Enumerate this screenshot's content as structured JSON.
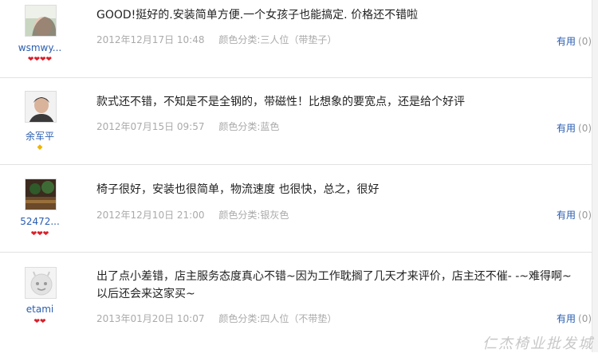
{
  "reviews": [
    {
      "username": "wsmwy...",
      "badge": "❤❤❤❤",
      "content": "GOOD!挺好的.安装简单方便.一个女孩子也能搞定. 价格还不错啦",
      "date": "2012年12月17日 10:48",
      "variant": "颜色分类:三人位（带垫子）",
      "useful_label": "有用",
      "useful_count": "(0)"
    },
    {
      "username": "余军平",
      "badge": "◆",
      "content": "款式还不错，不知是不是全钢的，带磁性！比想象的要宽点，还是给个好评",
      "date": "2012年07月15日 09:57",
      "variant": "颜色分类:蓝色",
      "useful_label": "有用",
      "useful_count": "(0)"
    },
    {
      "username": "52472...",
      "badge": "❤❤❤",
      "content": "椅子很好，安装也很简单，物流速度 也很快，总之，很好",
      "date": "2012年12月10日 21:00",
      "variant": "颜色分类:银灰色",
      "useful_label": "有用",
      "useful_count": "(0)"
    },
    {
      "username": "etami",
      "badge": "❤❤",
      "content": "出了点小差错，店主服务态度真心不错~因为工作耽搁了几天才来评价，店主还不催- -~难得啊~以后还会来这家买~",
      "date": "2013年01月20日 10:07",
      "variant": "颜色分类:四人位（不带垫）",
      "useful_label": "有用",
      "useful_count": "(0)"
    }
  ],
  "watermark": "仁杰椅业批发城"
}
